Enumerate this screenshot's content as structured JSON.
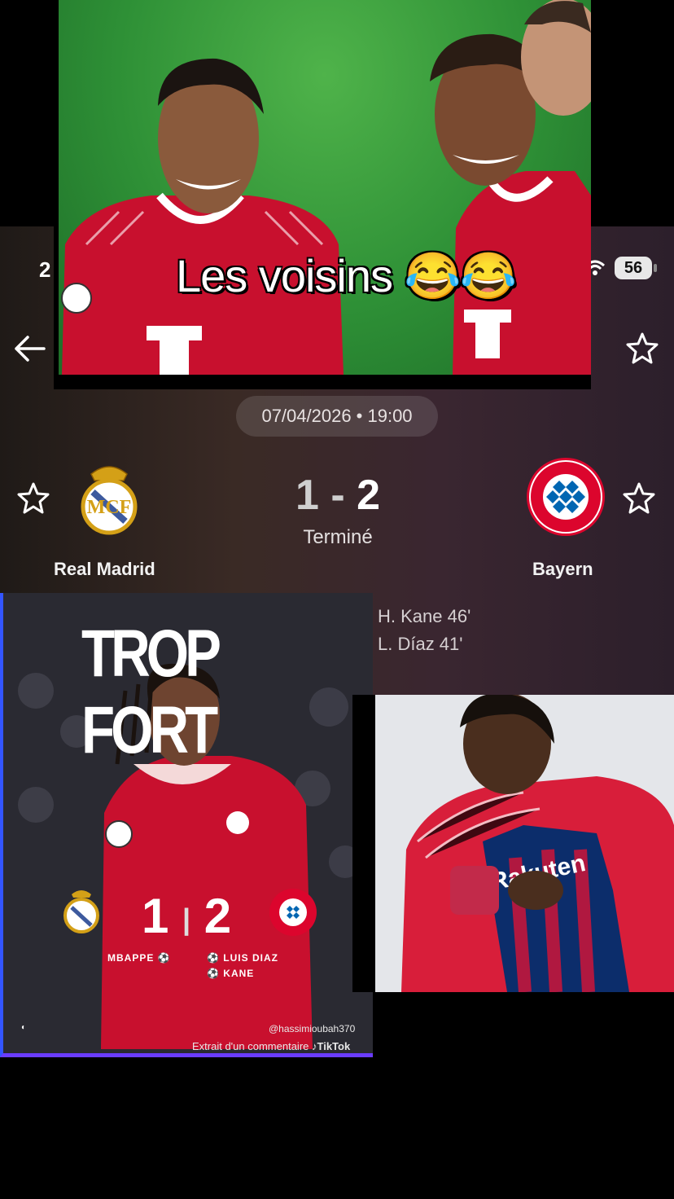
{
  "status_bar": {
    "time": "2",
    "battery": "56"
  },
  "match": {
    "datetime": "07/04/2026 • 19:00",
    "home_team": "Real Madrid",
    "away_team": "Bayern",
    "home_score": "1",
    "separator": "-",
    "away_score": "2",
    "status": "Terminé",
    "scorers": [
      "H. Kane 46'",
      "L. Díaz 41'"
    ]
  },
  "caption": {
    "text": "Les voisins 😂😂"
  },
  "poster": {
    "title": "TROP FORT",
    "home_score": "1",
    "away_score": "2",
    "home_scorers": [
      "MBAPPE"
    ],
    "away_scorers": [
      "LUIS DIAZ",
      "KANE"
    ],
    "handle": "@hassimioubah370",
    "extract": "Extrait d'un commentaire",
    "tiktok": "TikTok"
  },
  "colors": {
    "bayern_red": "#dc052d",
    "real_gold": "#d4a017",
    "accent_blue": "#3355ff"
  }
}
